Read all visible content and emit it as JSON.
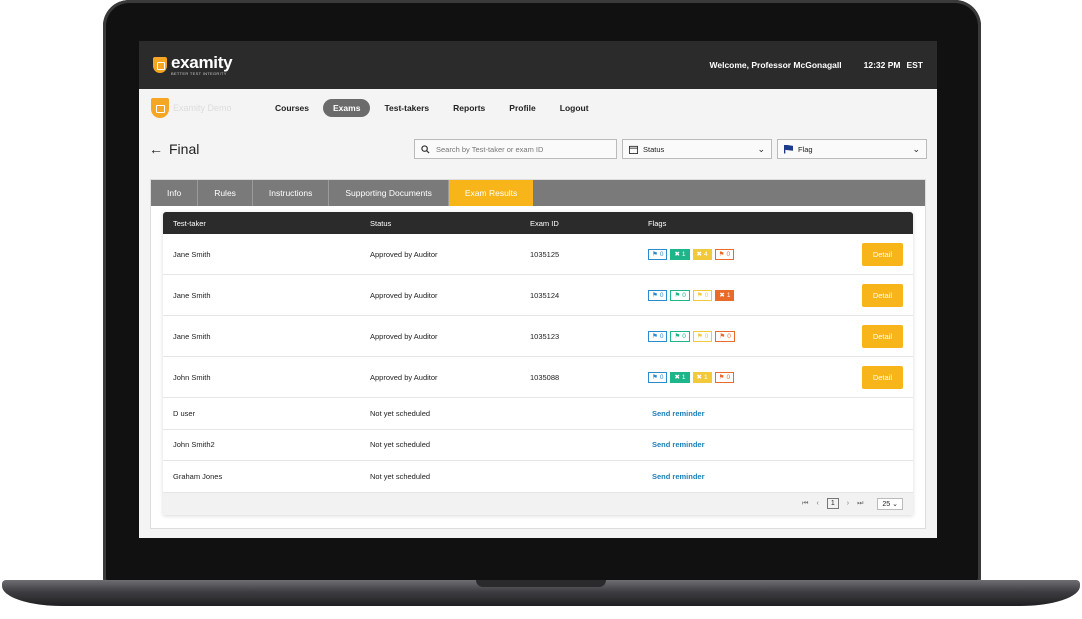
{
  "header": {
    "brand": "examity",
    "tagline": "BETTER TEST INTEGRITY",
    "welcome": "Welcome, Professor McGonagall",
    "time": "12:32 PM",
    "timezone": "EST"
  },
  "nav": {
    "brand_label": "Examity Demo",
    "items": [
      {
        "label": "Courses"
      },
      {
        "label": "Exams"
      },
      {
        "label": "Test-takers"
      },
      {
        "label": "Reports"
      },
      {
        "label": "Profile"
      },
      {
        "label": "Logout"
      }
    ],
    "active": "Exams"
  },
  "page": {
    "title": "Final",
    "search_placeholder": "Search by Test-taker or exam ID",
    "status_filter": "Status",
    "flag_filter": "Flag"
  },
  "tabs": [
    {
      "label": "Info"
    },
    {
      "label": "Rules"
    },
    {
      "label": "Instructions"
    },
    {
      "label": "Supporting Documents"
    },
    {
      "label": "Exam Results"
    }
  ],
  "table": {
    "columns": [
      "Test-taker",
      "Status",
      "Exam ID",
      "Flags"
    ],
    "rows": [
      {
        "name": "Jane Smith",
        "status": "Approved by Auditor",
        "exam_id": "1035125",
        "flags": [
          "0",
          "1",
          "4",
          "0"
        ],
        "action": "Detail"
      },
      {
        "name": "Jane Smith",
        "status": "Approved by Auditor",
        "exam_id": "1035124",
        "flags": [
          "0",
          "0",
          "0",
          "1"
        ],
        "action": "Detail"
      },
      {
        "name": "Jane Smith",
        "status": "Approved by Auditor",
        "exam_id": "1035123",
        "flags": [
          "0",
          "0",
          "0",
          "0"
        ],
        "action": "Detail"
      },
      {
        "name": "John Smith",
        "status": "Approved by Auditor",
        "exam_id": "1035088",
        "flags": [
          "0",
          "1",
          "1",
          "0"
        ],
        "action": "Detail"
      },
      {
        "name": "D user",
        "status": "Not yet scheduled",
        "exam_id": "",
        "link": "Send reminder"
      },
      {
        "name": "John Smith2",
        "status": "Not yet scheduled",
        "exam_id": "",
        "link": "Send reminder"
      },
      {
        "name": "Graham Jones",
        "status": "Not yet scheduled",
        "exam_id": "",
        "link": "Send reminder"
      }
    ]
  },
  "pagination": {
    "page": "1",
    "page_size": "25"
  },
  "colors": {
    "accent": "#f7b519",
    "topbar": "#2b2b2b",
    "blue_flag": "#2a8bd0",
    "green_flag": "#1fb58a",
    "yellow_flag": "#f3c93c",
    "orange_flag": "#ea6a2a",
    "link": "#1a7fb8"
  }
}
